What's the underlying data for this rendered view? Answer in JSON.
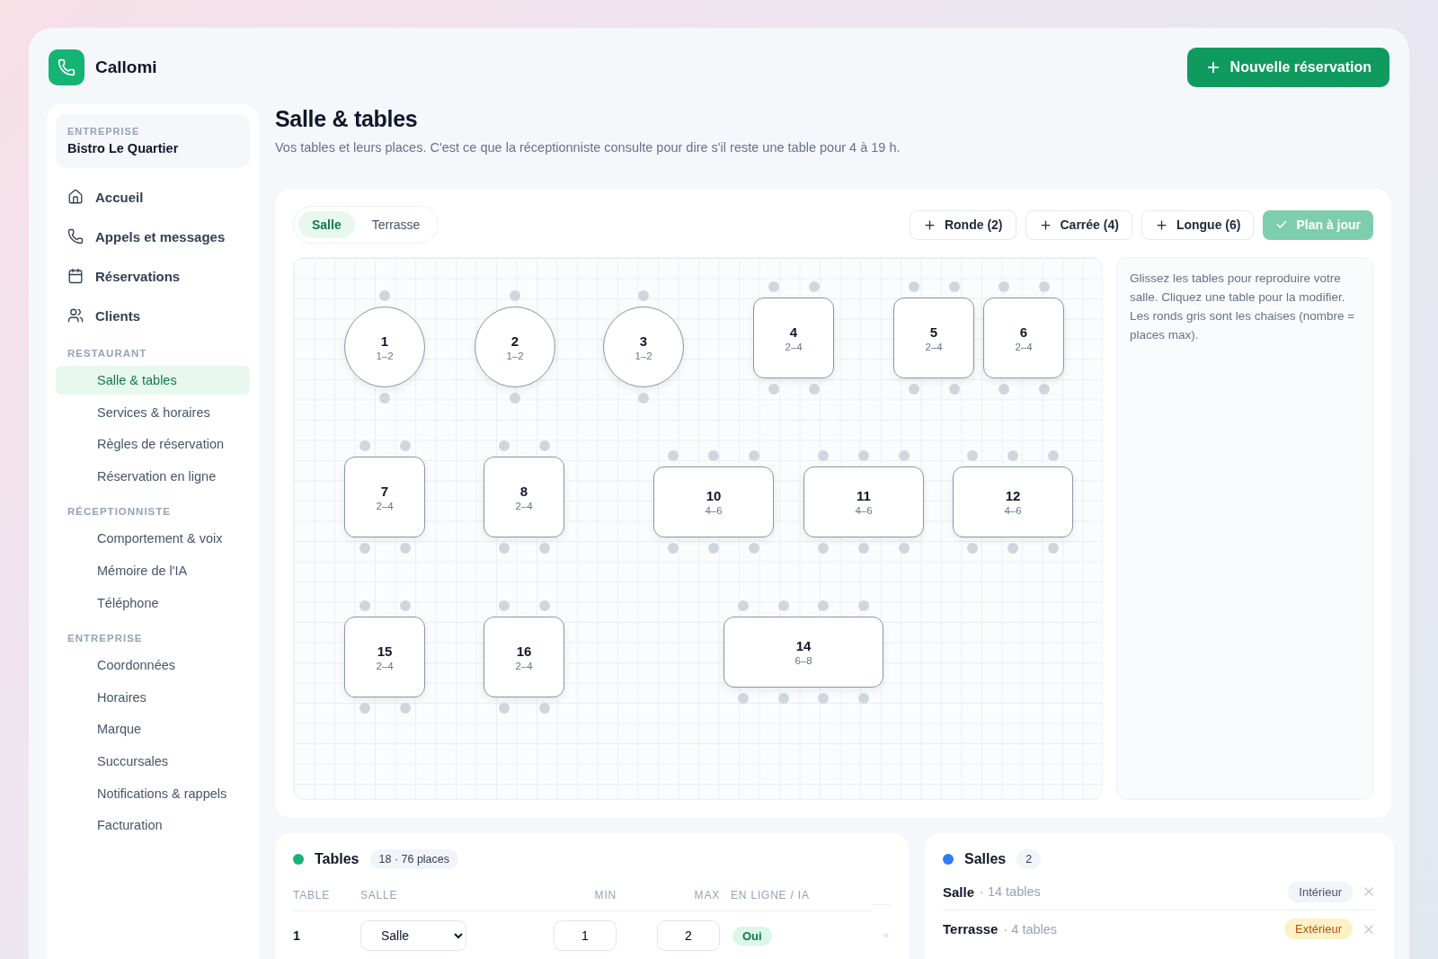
{
  "brand": {
    "name": "Callomi"
  },
  "new_button": {
    "label": "Nouvelle réservation"
  },
  "sidebar": {
    "org_label": "ENTREPRISE",
    "org_name": "Bistro Le Quartier",
    "main_items": [
      {
        "label": "Accueil",
        "kind": "home",
        "selected": false
      },
      {
        "label": "Appels et messages",
        "kind": "phone",
        "selected": false
      },
      {
        "label": "Réservations",
        "kind": "calendar",
        "selected": false
      },
      {
        "label": "Clients",
        "kind": "users",
        "selected": false
      }
    ],
    "sections": [
      {
        "title": "RESTAURANT",
        "items": [
          {
            "label": "Salle & tables",
            "selected": true
          },
          {
            "label": "Services & horaires",
            "selected": false
          },
          {
            "label": "Règles de réservation",
            "selected": false
          },
          {
            "label": "Réservation en ligne",
            "selected": false
          }
        ]
      },
      {
        "title": "RÉCEPTIONNISTE",
        "items": [
          {
            "label": "Comportement & voix",
            "selected": false
          },
          {
            "label": "Mémoire de l'IA",
            "selected": false
          },
          {
            "label": "Téléphone",
            "selected": false
          }
        ]
      },
      {
        "title": "ENTREPRISE",
        "items": [
          {
            "label": "Coordonnées",
            "selected": false
          },
          {
            "label": "Horaires",
            "selected": false
          },
          {
            "label": "Marque",
            "selected": false
          },
          {
            "label": "Succursales",
            "selected": false
          },
          {
            "label": "Notifications & rappels",
            "selected": false
          },
          {
            "label": "Facturation",
            "selected": false
          }
        ]
      }
    ]
  },
  "page": {
    "title": "Salle & tables",
    "subtitle": "Vos tables et leurs places. C'est ce que la réceptionniste consulte pour dire s'il reste une table pour 4 à 19 h."
  },
  "plan": {
    "tabs": [
      {
        "label": "Salle",
        "selected": true
      },
      {
        "label": "Terrasse",
        "selected": false
      }
    ],
    "add_buttons": [
      "Ronde (2)",
      "Carrée (4)",
      "Longue (6)"
    ],
    "save_button": {
      "label": "Plan à jour",
      "disabled": true
    },
    "tables": [
      {
        "number": "1",
        "seats": "1–2",
        "kind": "round"
      },
      {
        "number": "2",
        "seats": "1–2",
        "kind": "round"
      },
      {
        "number": "3",
        "seats": "1–2",
        "kind": "round"
      },
      {
        "number": "4",
        "seats": "2–4",
        "kind": "square"
      },
      {
        "number": "5",
        "seats": "2–4",
        "kind": "square"
      },
      {
        "number": "6",
        "seats": "2–4",
        "kind": "square"
      },
      {
        "number": "7",
        "seats": "2–4",
        "kind": "square"
      },
      {
        "number": "8",
        "seats": "2–4",
        "kind": "square"
      },
      {
        "number": "10",
        "seats": "4–6",
        "kind": "long"
      },
      {
        "number": "11",
        "seats": "4–6",
        "kind": "long"
      },
      {
        "number": "12",
        "seats": "4–6",
        "kind": "long"
      },
      {
        "number": "15",
        "seats": "2–4",
        "kind": "square"
      },
      {
        "number": "16",
        "seats": "2–4",
        "kind": "square"
      },
      {
        "number": "14",
        "seats": "6–8",
        "kind": "xlong"
      }
    ],
    "help": "Glissez les tables pour reproduire votre salle. Cliquez une table pour la modifier. Les ronds gris sont les chaises (nombre = places max)."
  },
  "tables_panel": {
    "title": "Tables",
    "badge": "18 · 76 places",
    "columns": [
      "TABLE",
      "SALLE",
      "MIN",
      "MAX",
      "EN LIGNE / IA"
    ],
    "rows": [
      {
        "table": "1",
        "room": "Salle",
        "min": "1",
        "max": "2",
        "online": "Oui",
        "online_on": true
      }
    ]
  },
  "rooms_panel": {
    "title": "Salles",
    "badge": "2",
    "rooms": [
      {
        "name": "Salle",
        "count": "· 14 tables",
        "tag": "Intérieur",
        "kind": "indoor"
      },
      {
        "name": "Terrasse",
        "count": "· 4 tables",
        "tag": "Extérieur",
        "kind": "outdoor"
      }
    ]
  }
}
